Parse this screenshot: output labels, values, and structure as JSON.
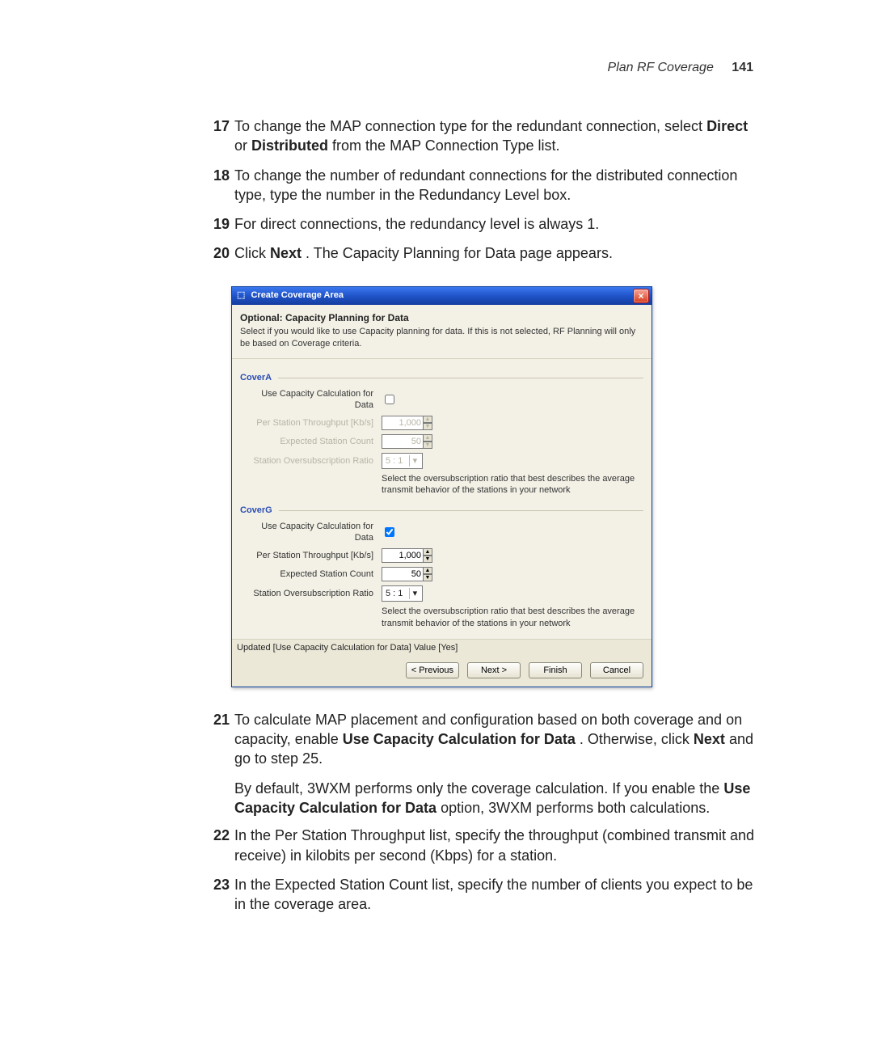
{
  "header": {
    "section": "Plan RF Coverage",
    "page": "141"
  },
  "steps": {
    "s17": {
      "num": "17",
      "t1": "To change the MAP connection type for the redundant connection, select ",
      "b1": "Direct",
      "t2": " or ",
      "b2": "Distributed",
      "t3": " from the MAP Connection Type list."
    },
    "s18": {
      "num": "18",
      "t1": "To change the number of redundant connections for the distributed connection type, type the number in the Redundancy Level box."
    },
    "s19": {
      "num": "19",
      "t1": "For direct connections, the redundancy level is always 1."
    },
    "s20": {
      "num": "20",
      "t1": "Click ",
      "b1": "Next",
      "t2": ". The Capacity Planning for Data page appears."
    },
    "s21": {
      "num": "21",
      "t1": "To calculate MAP placement and configuration based on both coverage and on capacity, enable ",
      "b1": "Use Capacity Calculation for Data",
      "t2": ". Otherwise, click ",
      "b2": "Next",
      "t3": " and go to step 25."
    },
    "p21b": {
      "t1": "By default, 3WXM performs only the coverage calculation. If you enable the ",
      "b1": "Use Capacity Calculation for Data",
      "t2": " option, 3WXM performs both calculations."
    },
    "s22": {
      "num": "22",
      "t1": "In the Per Station Throughput list, specify the throughput (combined transmit and receive) in kilobits per second (Kbps) for a station."
    },
    "s23": {
      "num": "23",
      "t1": "In the Expected Station Count list, specify the number of clients you expect to be in the coverage area."
    }
  },
  "dialog": {
    "title": "Create Coverage Area",
    "heading": "Optional: Capacity Planning for Data",
    "sub": "Select if you would like to use Capacity planning for data. If this is not selected, RF Planning will only be based on Coverage criteria.",
    "labels": {
      "useCapacity": "Use Capacity Calculation for Data",
      "throughput": "Per Station Throughput [Kb/s]",
      "stationCount": "Expected Station Count",
      "ratio": "Station Oversubscription Ratio"
    },
    "hint": "Select the oversubscription ratio that best describes the average transmit behavior of the stations in your network",
    "coverA": {
      "legend": "CoverA",
      "useCapacity": false,
      "throughput": "1,000",
      "stationCount": "50",
      "ratio": "5 : 1"
    },
    "coverG": {
      "legend": "CoverG",
      "useCapacity": true,
      "throughput": "1,000",
      "stationCount": "50",
      "ratio": "5 : 1"
    },
    "status": "Updated [Use Capacity Calculation for Data] Value [Yes]",
    "buttons": {
      "prev": "< Previous",
      "next": "Next >",
      "finish": "Finish",
      "cancel": "Cancel"
    }
  }
}
